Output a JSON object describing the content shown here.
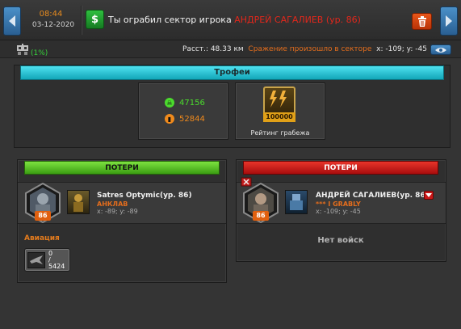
{
  "header": {
    "time": "08:44",
    "date": "03-12-2020",
    "message_prefix": "Ты ограбил сектор игрока",
    "message_player": "АНДРЕЙ САГАЛИЕВ (ур. 86)",
    "money_icon": "dollar-icon",
    "trash_icon": "trash-icon"
  },
  "infobar": {
    "percent": "(1%)",
    "distance": "Расст.: 48.33 км",
    "battle_text": "Сражение произошло в секторе",
    "coords": "x: -109; y: -45",
    "eye_icon": "eye-icon"
  },
  "trophies": {
    "title": "Трофеи",
    "resources": [
      {
        "value": "47156",
        "icon": "skull-icon",
        "color": "#4bdb2d"
      },
      {
        "value": "52844",
        "icon": "barrel-icon",
        "color": "#f08a1c"
      }
    ],
    "rating_value": "100000",
    "rating_label": "Рейтинг грабежа"
  },
  "left_panel": {
    "title": "ПОТЕРИ",
    "player_name": "Satres Optymic(ур. 86)",
    "clan": "АНКЛАВ",
    "coords": "x: -89; y: -89",
    "level": "86",
    "aviation_label": "Авиация",
    "unit_lost": "0",
    "unit_sep": "/",
    "unit_total": "5424"
  },
  "right_panel": {
    "title": "ПОТЕРИ",
    "player_name": "АНДРЕЙ САГАЛИЕВ(ур. 86)",
    "clan": "*** I GRABLY",
    "coords": "x: -109; y: -45",
    "level": "86",
    "no_troops": "Нет войск"
  },
  "colors": {
    "accent_blue": "#2a5f92",
    "green": "#3b9e12",
    "red": "#a90d0d",
    "orange": "#e36d1d",
    "cyan": "#12a6b8"
  }
}
